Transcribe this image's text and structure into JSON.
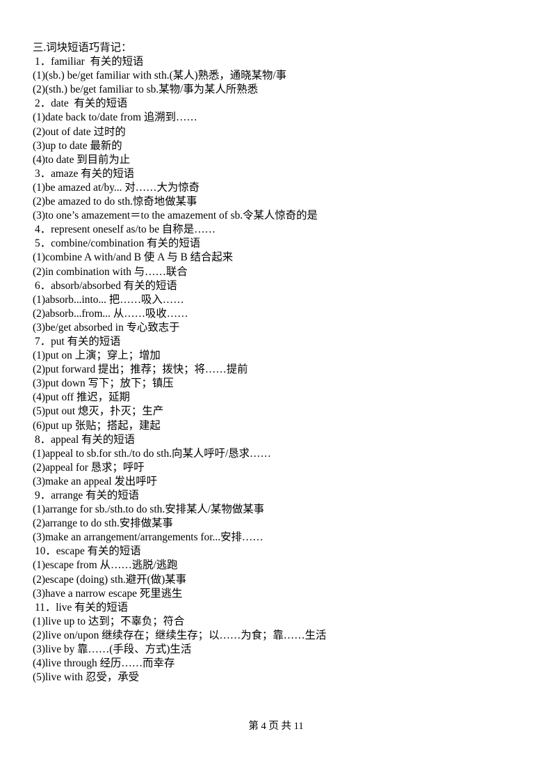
{
  "document": {
    "section_heading": "三.词块短语巧背记：",
    "lines": [
      {
        "type": "num",
        "text": "1．familiar  有关的短语"
      },
      {
        "type": "sub",
        "text": "(1)(sb.) be/get familiar with sth.(某人)熟悉，通晓某物/事"
      },
      {
        "type": "sub",
        "text": "(2)(sth.) be/get familiar to sb.某物/事为某人所熟悉"
      },
      {
        "type": "num",
        "text": "2．date  有关的短语"
      },
      {
        "type": "sub",
        "text": "(1)date back to/date from 追溯到……"
      },
      {
        "type": "sub",
        "text": "(2)out of date 过时的"
      },
      {
        "type": "sub",
        "text": "(3)up to date 最新的"
      },
      {
        "type": "sub",
        "text": "(4)to date 到目前为止"
      },
      {
        "type": "num",
        "text": "3．amaze 有关的短语"
      },
      {
        "type": "sub",
        "text": "(1)be amazed at/by... 对……大为惊奇"
      },
      {
        "type": "sub",
        "text": "(2)be amazed to do sth.惊奇地做某事"
      },
      {
        "type": "sub",
        "text": "(3)to one’s amazement＝to the amazement of sb.令某人惊奇的是"
      },
      {
        "type": "num",
        "text": "4．represent oneself as/to be 自称是……"
      },
      {
        "type": "num",
        "text": "5．combine/combination 有关的短语"
      },
      {
        "type": "sub",
        "text": "(1)combine A with/and B 使 A 与 B 结合起来"
      },
      {
        "type": "sub",
        "text": "(2)in combination with 与……联合"
      },
      {
        "type": "num",
        "text": "6．absorb/absorbed 有关的短语"
      },
      {
        "type": "sub",
        "text": "(1)absorb...into... 把……吸入……"
      },
      {
        "type": "sub",
        "text": "(2)absorb...from... 从……吸收……"
      },
      {
        "type": "sub",
        "text": "(3)be/get absorbed in 专心致志于"
      },
      {
        "type": "num",
        "text": "7．put 有关的短语"
      },
      {
        "type": "sub",
        "text": "(1)put on 上演；穿上；增加"
      },
      {
        "type": "sub",
        "text": "(2)put forward 提出；推荐；拨快；将……提前"
      },
      {
        "type": "sub",
        "text": "(3)put down 写下；放下；镇压"
      },
      {
        "type": "sub",
        "text": "(4)put off 推迟，延期"
      },
      {
        "type": "sub",
        "text": "(5)put out 熄灭，扑灭；生产"
      },
      {
        "type": "sub",
        "text": "(6)put up 张贴；搭起，建起"
      },
      {
        "type": "num",
        "text": "8．appeal 有关的短语"
      },
      {
        "type": "sub",
        "text": "(1)appeal to sb.for sth./to do sth.向某人呼吁/恳求……"
      },
      {
        "type": "sub",
        "text": "(2)appeal for 恳求；呼吁"
      },
      {
        "type": "sub",
        "text": "(3)make an appeal 发出呼吁"
      },
      {
        "type": "num",
        "text": "9．arrange 有关的短语"
      },
      {
        "type": "sub",
        "text": "(1)arrange for sb./sth.to do sth.安排某人/某物做某事"
      },
      {
        "type": "sub",
        "text": "(2)arrange to do sth.安排做某事"
      },
      {
        "type": "sub",
        "text": "(3)make an arrangement/arrangements for...安排……"
      },
      {
        "type": "num",
        "text": "10．escape 有关的短语"
      },
      {
        "type": "sub",
        "text": "(1)escape from 从……逃脱/逃跑"
      },
      {
        "type": "sub",
        "text": "(2)escape (doing) sth.避开(做)某事"
      },
      {
        "type": "sub",
        "text": "(3)have a narrow escape 死里逃生"
      },
      {
        "type": "num",
        "text": "11．live 有关的短语"
      },
      {
        "type": "sub",
        "text": "(1)live up to 达到；不辜负；符合"
      },
      {
        "type": "sub",
        "text": "(2)live on/upon 继续存在；继续生存；以……为食；靠……生活"
      },
      {
        "type": "sub",
        "text": "(3)live by 靠……(手段、方式)生活"
      },
      {
        "type": "sub",
        "text": "(4)live through 经历……而幸存"
      },
      {
        "type": "sub",
        "text": "(5)live with 忍受，承受"
      }
    ],
    "footer": "第 4 页 共 11"
  }
}
